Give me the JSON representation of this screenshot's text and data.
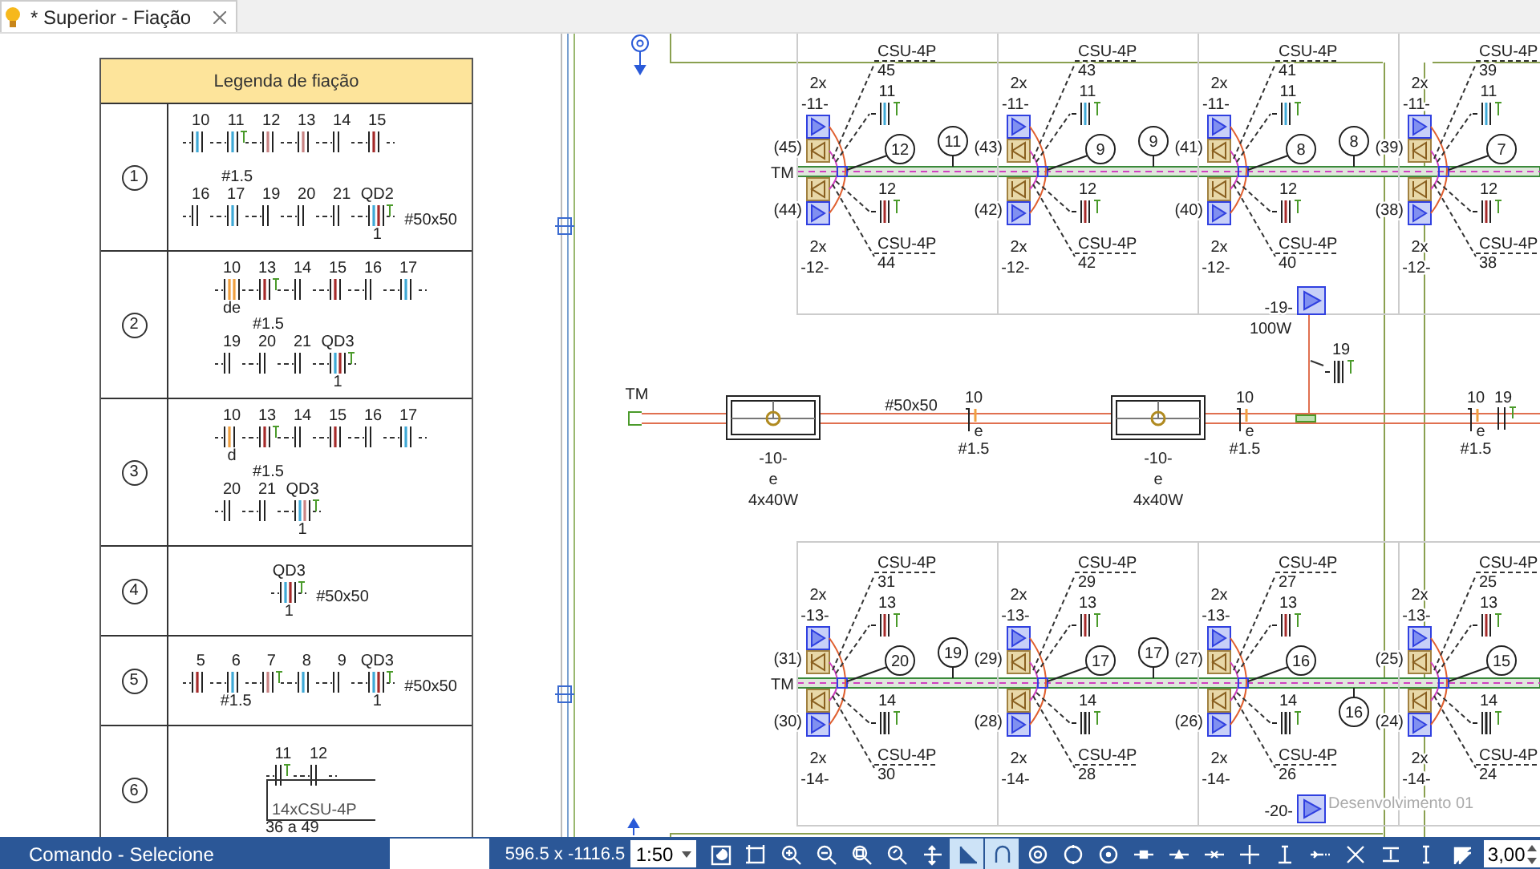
{
  "tab": {
    "title": "* Superior - Fiação"
  },
  "legend": {
    "title": "Legenda de fiação",
    "rows": [
      {
        "number": "1",
        "kind": "circuit",
        "gauge": "#1.5",
        "pipe": "#50x50",
        "lines": [
          {
            "items": [
              {
                "label": "10",
                "wires": [
                  {
                    "color": "#3fa9d6"
                  }
                ],
                "tee": false
              },
              {
                "label": "11",
                "wires": [
                  {
                    "color": "#3fa9d6"
                  }
                ],
                "tee": true
              },
              {
                "label": "12",
                "wires": [
                  {
                    "color": "#c98484"
                  }
                ],
                "tee": false
              },
              {
                "label": "13",
                "wires": [
                  {
                    "color": "#c98484"
                  }
                ],
                "tee": false
              },
              {
                "label": "14",
                "tee": false
              },
              {
                "label": "15",
                "wires": [
                  {
                    "color": "#a52a2a"
                  }
                ],
                "tee": false
              }
            ]
          },
          {
            "items": [
              {
                "label": "16",
                "tee": false
              },
              {
                "label": "17",
                "wires": [
                  {
                    "color": "#3fa9d6"
                  }
                ],
                "tee": false
              },
              {
                "label": "19",
                "tee": false
              },
              {
                "label": "20",
                "tee": false
              },
              {
                "label": "21",
                "tee": false
              },
              {
                "label": "QD2",
                "wires": [
                  {
                    "color": "#3fa9d6"
                  },
                  {
                    "color": "#a52a2a"
                  }
                ],
                "tee": true,
                "sub": "1"
              }
            ]
          }
        ]
      },
      {
        "number": "2",
        "kind": "circuit",
        "gauge": "#1.5",
        "lines": [
          {
            "items": [
              {
                "label": "10",
                "wires": [
                  {
                    "color": "#f0a040"
                  },
                  {
                    "color": "#f0a040"
                  }
                ],
                "tee": false,
                "sub": "de"
              },
              {
                "label": "13",
                "wires": [
                  {
                    "color": "#a52a2a"
                  }
                ],
                "tee": true
              },
              {
                "label": "14",
                "tee": false
              },
              {
                "label": "15",
                "wires": [
                  {
                    "color": "#a52a2a"
                  }
                ],
                "tee": false
              },
              {
                "label": "16",
                "tee": false
              },
              {
                "label": "17",
                "wires": [
                  {
                    "color": "#3fa9d6"
                  }
                ],
                "tee": false
              }
            ]
          },
          {
            "items": [
              {
                "label": "19",
                "tee": false
              },
              {
                "label": "20",
                "tee": false
              },
              {
                "label": "21",
                "tee": false
              },
              {
                "label": "QD3",
                "wires": [
                  {
                    "color": "#3fa9d6"
                  },
                  {
                    "color": "#a52a2a"
                  }
                ],
                "tee": true,
                "sub": "1"
              }
            ]
          }
        ]
      },
      {
        "number": "3",
        "kind": "circuit",
        "gauge": "#1.5",
        "lines": [
          {
            "items": [
              {
                "label": "10",
                "wires": [
                  {
                    "color": "#f0a040"
                  }
                ],
                "tee": false,
                "sub": "d"
              },
              {
                "label": "13",
                "wires": [
                  {
                    "color": "#a52a2a"
                  }
                ],
                "tee": true
              },
              {
                "label": "14",
                "tee": false
              },
              {
                "label": "15",
                "wires": [
                  {
                    "color": "#a52a2a"
                  }
                ],
                "tee": false
              },
              {
                "label": "16",
                "tee": false
              },
              {
                "label": "17",
                "wires": [
                  {
                    "color": "#3fa9d6"
                  }
                ],
                "tee": false
              }
            ]
          },
          {
            "items": [
              {
                "label": "20",
                "tee": false
              },
              {
                "label": "21",
                "tee": false
              },
              {
                "label": "QD3",
                "wires": [
                  {
                    "color": "#3fa9d6"
                  },
                  {
                    "color": "#c98484"
                  }
                ],
                "tee": true,
                "sub": "1"
              }
            ]
          }
        ]
      },
      {
        "number": "4",
        "kind": "circuit",
        "pipe": "#50x50",
        "lines": [
          {
            "items": [
              {
                "label": "QD3",
                "wires": [
                  {
                    "color": "#3fa9d6"
                  },
                  {
                    "color": "#a52a2a"
                  }
                ],
                "tee": true,
                "sub": "1"
              }
            ]
          }
        ]
      },
      {
        "number": "5",
        "kind": "circuit",
        "pipe": "#50x50",
        "lines": [
          {
            "items": [
              {
                "label": "5",
                "wires": [
                  {
                    "color": "#a52a2a"
                  }
                ],
                "tee": false
              },
              {
                "label": "6",
                "wires": [
                  {
                    "color": "#3fa9d6"
                  }
                ],
                "tee": false,
                "sub": "#1.5"
              },
              {
                "label": "7",
                "wires": [
                  {
                    "color": "#c98484"
                  }
                ],
                "tee": true
              },
              {
                "label": "8",
                "wires": [
                  {
                    "color": "#3fa9d6"
                  }
                ],
                "tee": false
              },
              {
                "label": "9",
                "tee": false
              },
              {
                "label": "QD3",
                "wires": [
                  {
                    "color": "#3fa9d6"
                  },
                  {
                    "color": "#a52a2a"
                  }
                ],
                "tee": true,
                "sub": "1"
              }
            ]
          }
        ]
      },
      {
        "number": "6",
        "kind": "fixture",
        "switches": [
          {
            "label": "11",
            "tee": true
          },
          {
            "label": "12",
            "tee": false
          }
        ],
        "model": "14xCSU-4P",
        "range": "36 a 49"
      }
    ]
  },
  "drawing": {
    "top_row": {
      "tm": "TM",
      "bays": [
        {
          "upper": {
            "count": "2x",
            "id": "-11-",
            "ref": "(45)",
            "fixture": "CSU-4P",
            "fixture_no": "45",
            "switch": "11"
          },
          "lower": {
            "count": "2x",
            "id": "-12-",
            "ref": "(44)",
            "fixture": "CSU-4P",
            "fixture_no": "44",
            "switch": "12"
          },
          "node": "12",
          "line_tag": "11",
          "tag_below": false
        },
        {
          "upper": {
            "count": "2x",
            "id": "-11-",
            "ref": "(43)",
            "fixture": "CSU-4P",
            "fixture_no": "43",
            "switch": "11"
          },
          "lower": {
            "count": "2x",
            "id": "-12-",
            "ref": "(42)",
            "fixture": "CSU-4P",
            "fixture_no": "42",
            "switch": "12"
          },
          "node": "9",
          "line_tag": "9",
          "tag_below": false
        },
        {
          "upper": {
            "count": "2x",
            "id": "-11-",
            "ref": "(41)",
            "fixture": "CSU-4P",
            "fixture_no": "41",
            "switch": "11"
          },
          "lower": {
            "count": "2x",
            "id": "-12-",
            "ref": "(40)",
            "fixture": "CSU-4P",
            "fixture_no": "40",
            "switch": "12"
          },
          "node": "8",
          "line_tag": "8",
          "tag_below": false
        },
        {
          "upper": {
            "count": "2x",
            "id": "-11-",
            "ref": "(39)",
            "fixture": "CSU-4P",
            "fixture_no": "39",
            "switch": "11"
          },
          "lower": {
            "count": "2x",
            "id": "-12-",
            "ref": "(38)",
            "fixture": "CSU-4P",
            "fixture_no": "38",
            "switch": "12"
          },
          "node": "7"
        }
      ]
    },
    "feeder": {
      "tm": "TM",
      "pipe": "#50x50",
      "luminaires": [
        {
          "id": "-10-",
          "letter": "e",
          "power": "4x40W"
        },
        {
          "id": "-10-",
          "letter": "e",
          "power": "4x40W"
        }
      ],
      "drops": [
        {
          "circuit": "10",
          "letter": "e",
          "gauge": "#1.5"
        },
        {
          "circuit": "10",
          "letter": "e",
          "gauge": "#1.5"
        },
        {
          "circuit": "10",
          "letter": "e",
          "gauge": "#1.5"
        }
      ],
      "end_switch": "19",
      "pendant": {
        "id": "-19-",
        "power": "100W",
        "switch": "19"
      }
    },
    "bottom_row": {
      "tm": "TM",
      "bays": [
        {
          "upper": {
            "count": "2x",
            "id": "-13-",
            "ref": "(31)",
            "fixture": "CSU-4P",
            "fixture_no": "31",
            "switch": "13"
          },
          "lower": {
            "count": "2x",
            "id": "-14-",
            "ref": "(30)",
            "fixture": "CSU-4P",
            "fixture_no": "30",
            "switch": "14"
          },
          "node": "20",
          "line_tag": "19",
          "tag_below": false
        },
        {
          "upper": {
            "count": "2x",
            "id": "-13-",
            "ref": "(29)",
            "fixture": "CSU-4P",
            "fixture_no": "29",
            "switch": "13"
          },
          "lower": {
            "count": "2x",
            "id": "-14-",
            "ref": "(28)",
            "fixture": "CSU-4P",
            "fixture_no": "28",
            "switch": "14"
          },
          "node": "17",
          "line_tag": "17",
          "tag_below": false
        },
        {
          "upper": {
            "count": "2x",
            "id": "-13-",
            "ref": "(27)",
            "fixture": "CSU-4P",
            "fixture_no": "27",
            "switch": "13"
          },
          "lower": {
            "count": "2x",
            "id": "-14-",
            "ref": "(26)",
            "fixture": "CSU-4P",
            "fixture_no": "26",
            "switch": "14"
          },
          "node": "16",
          "line_tag": "16",
          "tag_below": true
        },
        {
          "upper": {
            "count": "2x",
            "id": "-13-",
            "ref": "(25)",
            "fixture": "CSU-4P",
            "fixture_no": "25",
            "switch": "13"
          },
          "lower": {
            "count": "2x",
            "id": "-14-",
            "ref": "(24)",
            "fixture": "CSU-4P",
            "fixture_no": "24",
            "switch": "14"
          },
          "node": "15"
        }
      ]
    },
    "lower_pendant": {
      "id": "-20-"
    },
    "sheet_label": "Desenvolvimento 01"
  },
  "status_bar": {
    "command": "Comando - Selecione",
    "coordinates": "596.5 x -1116.5",
    "scale": "1:50",
    "value": "3,00",
    "tools": [
      {
        "kind": "refresh",
        "on": false
      },
      {
        "kind": "fit",
        "on": false
      },
      {
        "kind": "zoom-in",
        "on": false
      },
      {
        "kind": "zoom-out",
        "on": false
      },
      {
        "kind": "zoom-window",
        "on": false
      },
      {
        "kind": "zoom-previous",
        "on": false
      },
      {
        "kind": "pan",
        "on": false
      },
      {
        "kind": "ortho",
        "on": true
      },
      {
        "kind": "magnet",
        "on": true
      },
      {
        "kind": "settings",
        "on": false
      },
      {
        "kind": "circle",
        "on": false
      },
      {
        "kind": "center",
        "on": false
      },
      {
        "kind": "endpoint",
        "on": false
      },
      {
        "kind": "midpoint",
        "on": false
      },
      {
        "kind": "nearest",
        "on": false
      },
      {
        "kind": "plus",
        "on": false
      },
      {
        "kind": "perpendicular",
        "on": false
      },
      {
        "kind": "extend",
        "on": false
      },
      {
        "kind": "cross",
        "on": false
      },
      {
        "kind": "align",
        "on": false
      },
      {
        "kind": "tangent",
        "on": false
      },
      {
        "kind": "corner",
        "on": false
      }
    ]
  }
}
